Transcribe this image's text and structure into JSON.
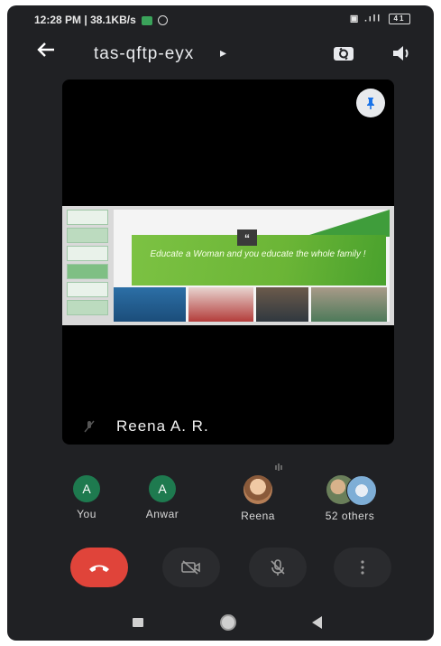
{
  "status_bar": {
    "time": "12:28 PM",
    "speed": "38.1KB/s",
    "battery": "41"
  },
  "header": {
    "meeting_code": "tas-qftp-eyx",
    "back_icon": "arrow-left-icon",
    "switch_camera_icon": "switch-camera-icon",
    "speaker_icon": "speaker-icon"
  },
  "main_tile": {
    "presenter_name": "Reena A. R.",
    "slide_quote": "Educate a Woman and you educate the whole family !",
    "pin_icon": "pin-icon"
  },
  "participants": [
    {
      "label": "You",
      "initial": "A"
    },
    {
      "label": "Anwar",
      "initial": "A"
    },
    {
      "label": "Reena"
    },
    {
      "label": "52 others"
    }
  ],
  "controls": {
    "end_call_icon": "end-call-icon",
    "camera_off_icon": "camera-off-icon",
    "mic_off_icon": "mic-off-icon",
    "more_icon": "more-vert-icon"
  },
  "colors": {
    "background": "#202124",
    "end_call": "#e0443a",
    "avatar_green": "#1e7a4f"
  }
}
